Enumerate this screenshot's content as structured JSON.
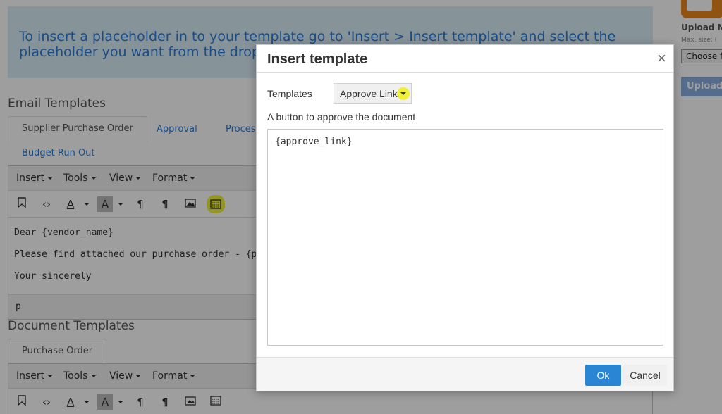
{
  "info_banner": {
    "text": "To insert a placeholder in to your template go to 'Insert > Insert template' and select the placeholder you want from the drop"
  },
  "email_templates": {
    "title": "Email Templates",
    "tabs": [
      {
        "label": "Supplier Purchase Order",
        "active": true
      },
      {
        "label": "Approval"
      },
      {
        "label": "Process"
      },
      {
        "label": "Budget Run Out"
      }
    ],
    "menubar": [
      "Insert",
      "Tools",
      "View",
      "Format"
    ],
    "content_lines": [
      "Dear {vendor_name}",
      "Please find attached our purchase order - {purch",
      "Your sincerely"
    ],
    "status_path": "p"
  },
  "document_templates": {
    "title": "Document Templates",
    "tabs": [
      {
        "label": "Purchase Order",
        "active": true
      }
    ],
    "menubar": [
      "Insert",
      "Tools",
      "View",
      "Format"
    ]
  },
  "right_panel": {
    "upload_label": "Upload N",
    "max_size": "Max. size: (",
    "choose_button": "Choose f",
    "upload_button": "Upload"
  },
  "modal": {
    "title": "Insert template",
    "close": "×",
    "templates_label": "Templates",
    "selected_template": "Approve Link",
    "description": "A button to approve the document",
    "preview": "{approve_link}",
    "ok_label": "Ok",
    "cancel_label": "Cancel"
  },
  "colors": {
    "link_blue": "#2a7bd8",
    "highlight_yellow": "#eef03a",
    "primary_button": "#2a86d4"
  }
}
